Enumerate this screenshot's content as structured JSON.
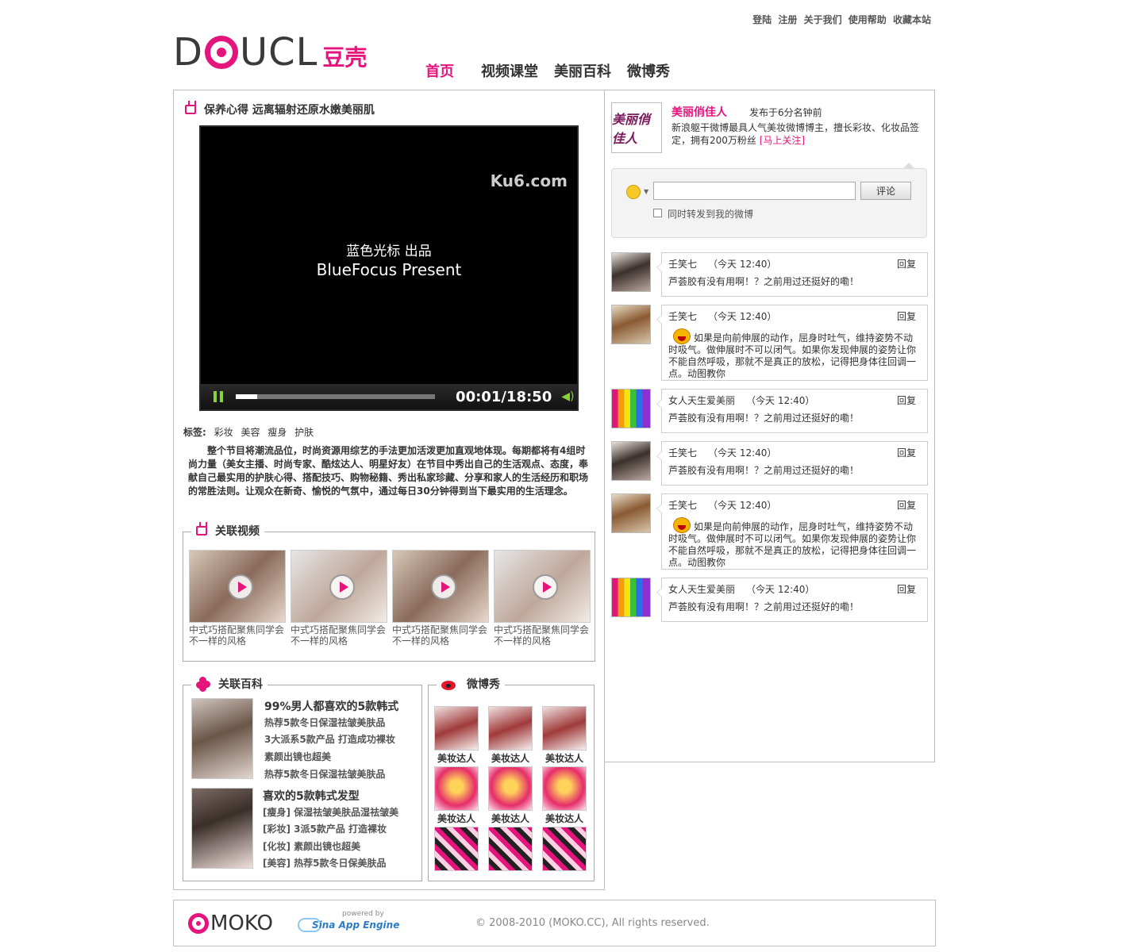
{
  "header": {
    "top_links": [
      "登陆",
      "注册",
      "关于我们",
      "使用帮助",
      "收藏本站"
    ],
    "logo_text_left": "D",
    "logo_text_right": "UCL",
    "logo_cn": "豆壳",
    "nav": [
      {
        "label": "首页",
        "active": true
      },
      {
        "label": "视频课堂",
        "active": false
      },
      {
        "label": "美丽百科",
        "active": false
      },
      {
        "label": "微博秀",
        "active": false
      }
    ]
  },
  "article": {
    "title": "保养心得 远离辐射还原水嫩美丽肌",
    "video": {
      "watermark": "Ku6.com",
      "present_cn": "蓝色光标 出品",
      "present_en": "BlueFocus Present",
      "time": "00:01/18:50",
      "progress": 0.11
    },
    "tags_label": "标签:",
    "tags": [
      "彩妆",
      "美容",
      "瘦身",
      "护肤"
    ],
    "description": "整个节目将潮流品位，时尚资源用综艺的手法更加活泼更加直观地体现。每期都将有4组时尚力量（美女主播、时尚专家、酷炫达人、明星好友）在节目中秀出自己的生活观点、态度，奉献自己最实用的护肤心得、搭配技巧、购物秘籍、秀出私家珍藏、分享和家人的生活经历和职场的常胜法则。让观众在新奇、愉悦的气氛中，通过每日30分钟得到当下最实用的生活理念。"
  },
  "related_videos": {
    "title": "关联视频",
    "items": [
      {
        "caption": "中式巧搭配聚焦同学会不一样的风格"
      },
      {
        "caption": "中式巧搭配聚焦同学会不一样的风格"
      },
      {
        "caption": "中式巧搭配聚焦同学会不一样的风格"
      },
      {
        "caption": "中式巧搭配聚焦同学会不一样的风格"
      }
    ]
  },
  "related_baike": {
    "title": "关联百科",
    "entries": [
      {
        "headline": "99%男人都喜欢的5款韩式",
        "lines": [
          "热荐5款冬日保湿祛皱美肤品",
          "3大派系5款产品 打造成功裸妆",
          "素颜出镜也超美",
          "热荐5款冬日保湿祛皱美肤品"
        ]
      },
      {
        "headline": "喜欢的5款韩式发型",
        "lines": [
          "[瘦身] 保湿祛皱美肤品湿祛皱美",
          "[彩妆] 3派5款产品 打造裸妆",
          "[化妆] 素颜出镜也超美",
          "[美容] 热荐5款冬日保美肤品"
        ]
      }
    ]
  },
  "weibo_show": {
    "title": "微博秀",
    "items": [
      {
        "label": "美妆达人"
      },
      {
        "label": "美妆达人"
      },
      {
        "label": "美妆达人"
      },
      {
        "label": "美妆达人"
      },
      {
        "label": "美妆达人"
      },
      {
        "label": "美妆达人"
      },
      {
        "label": ""
      },
      {
        "label": ""
      },
      {
        "label": ""
      }
    ]
  },
  "profile": {
    "avatar_text": "美丽俏佳人",
    "name": "美丽俏佳人",
    "time": "发布于6分名钟前",
    "bio": "新浪躯干微博最具人气美妆微博博主，擅长彩妆、化妆品签定，拥有200万粉丝",
    "follow": "[马上关注]"
  },
  "comment_form": {
    "input_value": "",
    "button": "评论",
    "repost_label": "同时转发到我的微博",
    "repost_checked": false
  },
  "comments": [
    {
      "user": "壬笑七",
      "time": "（今天 12:40）",
      "reply": "回复",
      "text": "芦荟胶有没有用啊！？之前用过还挺好的嘞！",
      "emoticon": false
    },
    {
      "user": "壬笑七",
      "time": "（今天 12:40）",
      "reply": "回复",
      "text": "如果是向前伸展的动作，屈身时吐气，维持姿势不动时吸气。做伸展时不可以闭气。如果你发现伸展的姿势让你不能自然呼吸，那就不是真正的放松，记得把身体往回调一点。动图教你",
      "emoticon": true
    },
    {
      "user": "女人天生爱美丽",
      "time": "（今天 12:40）",
      "reply": "回复",
      "text": "芦荟胶有没有用啊！？之前用过还挺好的嘞！",
      "emoticon": false
    },
    {
      "user": "壬笑七",
      "time": "（今天 12:40）",
      "reply": "回复",
      "text": "芦荟胶有没有用啊！？之前用过还挺好的嘞！",
      "emoticon": false
    },
    {
      "user": "壬笑七",
      "time": "（今天 12:40）",
      "reply": "回复",
      "text": "如果是向前伸展的动作，屈身时吐气，维持姿势不动时吸气。做伸展时不可以闭气。如果你发现伸展的姿势让你不能自然呼吸，那就不是真正的放松，记得把身体往回调一点。动图教你",
      "emoticon": true
    },
    {
      "user": "女人天生爱美丽",
      "time": "（今天 12:40）",
      "reply": "回复",
      "text": "芦荟胶有没有用啊！？之前用过还挺好的嘞！",
      "emoticon": false
    }
  ],
  "footer": {
    "moko_logo": "MOKO",
    "powered_by": "powered by",
    "sae_text": "Sina App Engine",
    "copyright": "© 2008-2010 (MOKO.CC), All rights reserved."
  },
  "colors": {
    "accent": "#e5147d",
    "weibo_red": "#e6162d",
    "progress_green": "#8bd23a"
  }
}
